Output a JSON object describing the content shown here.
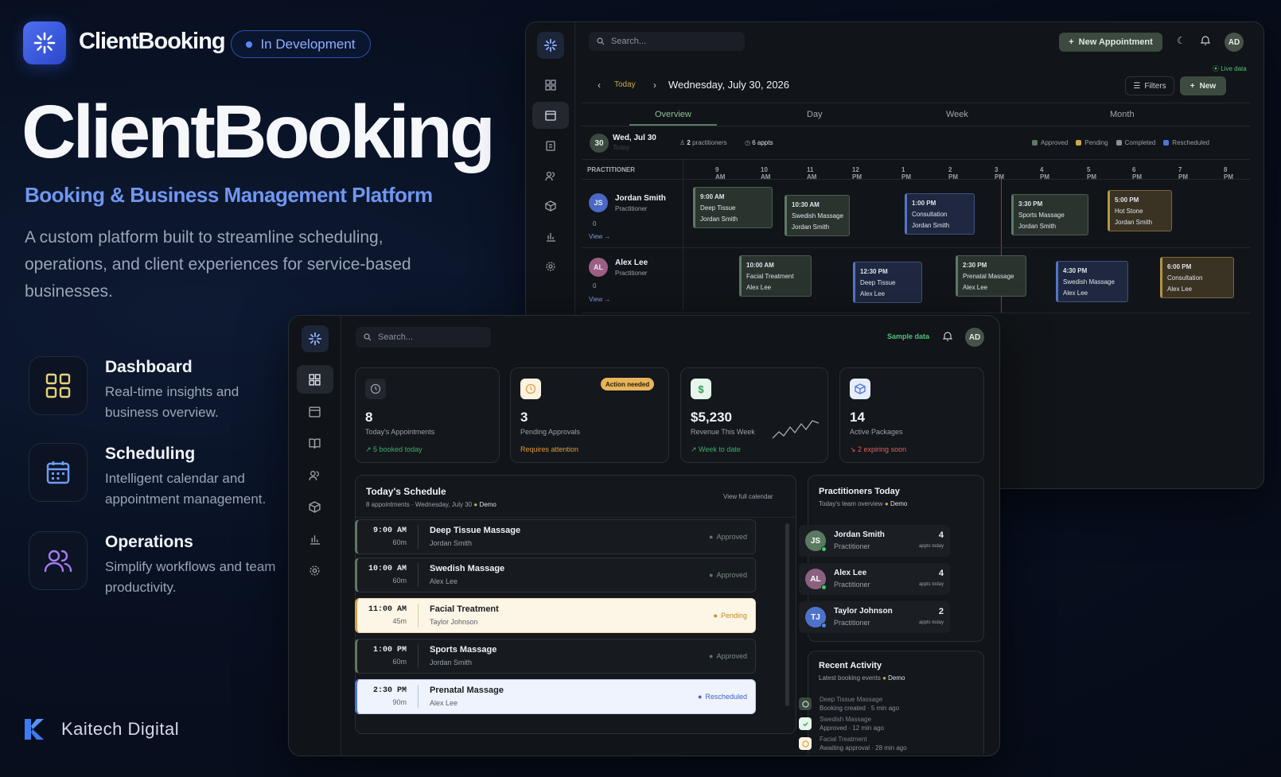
{
  "hero": {
    "brand": "ClientBooking",
    "status_pill": "In Development",
    "title": "ClientBooking",
    "subtitle": "Booking & Business Management Platform",
    "description": "A custom platform built to streamline scheduling, operations, and client experiences for service-based businesses.",
    "features": [
      {
        "title": "Dashboard",
        "desc": "Real-time insights and business overview.",
        "icon": "grid-icon"
      },
      {
        "title": "Scheduling",
        "desc": "Intelligent calendar and appointment management.",
        "icon": "calendar-icon"
      },
      {
        "title": "Operations",
        "desc": "Simplify workflows and team productivity.",
        "icon": "users-icon"
      }
    ],
    "company": "Kaitech Digital"
  },
  "calendar_window": {
    "search_placeholder": "Search...",
    "new_appointment": "New Appointment",
    "avatar": "AD",
    "live_data": "Live data",
    "today": "Today",
    "date": "Wednesday, July 30, 2026",
    "filters": "Filters",
    "new": "New",
    "tabs": [
      "Overview",
      "Day",
      "Week",
      "Month"
    ],
    "day_badge": "30",
    "day_label": "Wed, Jul 30",
    "day_sub": "Today",
    "practitioners_count": "2",
    "practitioners_label": "practitioners",
    "appts": "6 appts",
    "legend": [
      {
        "label": "Approved",
        "color": "#5c7a63"
      },
      {
        "label": "Pending",
        "color": "#c9a94a"
      },
      {
        "label": "Completed",
        "color": "#8a8f96"
      },
      {
        "label": "Rescheduled",
        "color": "#4f74d6"
      }
    ],
    "practitioner_header": "PRACTITIONER",
    "hours": [
      "9 AM",
      "10 AM",
      "11 AM",
      "12 PM",
      "1 PM",
      "2 PM",
      "3 PM",
      "4 PM",
      "5 PM",
      "6 PM",
      "7 PM",
      "8 PM"
    ],
    "rows": [
      {
        "initials": "JS",
        "name": "Jordan Smith",
        "role": "Practitioner",
        "count": "0",
        "view": "View →",
        "appointments": [
          {
            "time": "9:00 AM",
            "service": "Deep Tissue",
            "client": "Jordan Smith",
            "status": "green"
          },
          {
            "time": "10:30 AM",
            "service": "Swedish Massage",
            "client": "Jordan Smith",
            "status": "green"
          },
          {
            "time": "1:00 PM",
            "service": "Consultation",
            "client": "Jordan Smith",
            "status": "blue"
          },
          {
            "time": "3:30 PM",
            "service": "Sports Massage",
            "client": "Jordan Smith",
            "status": "green"
          },
          {
            "time": "5:00 PM",
            "service": "Hot Stone",
            "client": "Jordan Smith",
            "status": "gold"
          }
        ]
      },
      {
        "initials": "AL",
        "name": "Alex Lee",
        "role": "Practitioner",
        "count": "0",
        "view": "View →",
        "appointments": [
          {
            "time": "10:00 AM",
            "service": "Facial Treatment",
            "client": "Alex Lee",
            "status": "green"
          },
          {
            "time": "12:30 PM",
            "service": "Deep Tissue",
            "client": "Alex Lee",
            "status": "blue"
          },
          {
            "time": "2:30 PM",
            "service": "Prenatal Massage",
            "client": "Alex Lee",
            "status": "green"
          },
          {
            "time": "4:30 PM",
            "service": "Swedish Massage",
            "client": "Alex Lee",
            "status": "blue"
          },
          {
            "time": "6:00 PM",
            "service": "Consultation",
            "client": "Alex Lee",
            "status": "gold"
          }
        ]
      }
    ]
  },
  "dashboard_window": {
    "search_placeholder": "Search...",
    "sample_data": "Sample data",
    "avatar": "AD",
    "stats": [
      {
        "value": "8",
        "label": "Today's Appointments",
        "note": "↗ 5 booked today",
        "note_color": "#3fae6a",
        "icon": "clock-icon"
      },
      {
        "value": "3",
        "label": "Pending Approvals",
        "note": "Requires attention",
        "note_color": "#e09a3a",
        "badge": "Action needed",
        "icon": "clock-icon"
      },
      {
        "value": "$5,230",
        "label": "Revenue This Week",
        "note": "↗ Week to date",
        "note_color": "#3fae6a",
        "icon": "dollar-icon"
      },
      {
        "value": "14",
        "label": "Active Packages",
        "note": "↘ 2 expiring soon",
        "note_color": "#e0605a",
        "icon": "package-icon"
      }
    ],
    "schedule": {
      "title": "Today's Schedule",
      "subtitle": "8 appointments · Wednesday, July 30",
      "demo": "Demo",
      "view_full": "View full calendar",
      "items": [
        {
          "time": "9:00 AM",
          "duration": "60m",
          "service": "Deep Tissue Massage",
          "client": "Jordan Smith",
          "status": "Approved"
        },
        {
          "time": "10:00 AM",
          "duration": "60m",
          "service": "Swedish Massage",
          "client": "Alex Lee",
          "status": "Approved"
        },
        {
          "time": "11:00 AM",
          "duration": "45m",
          "service": "Facial Treatment",
          "client": "Taylor Johnson",
          "status": "Pending"
        },
        {
          "time": "1:00 PM",
          "duration": "60m",
          "service": "Sports Massage",
          "client": "Jordan Smith",
          "status": "Approved"
        },
        {
          "time": "2:30 PM",
          "duration": "90m",
          "service": "Prenatal Massage",
          "client": "Alex Lee",
          "status": "Rescheduled"
        }
      ]
    },
    "practitioners": {
      "title": "Practitioners Today",
      "subtitle": "Today's team overview",
      "demo": "Demo",
      "appts_label": "appts today",
      "items": [
        {
          "initials": "JS",
          "name": "Jordan Smith",
          "role": "Practitioner",
          "count": "4",
          "color": "#5a7a62"
        },
        {
          "initials": "AL",
          "name": "Alex Lee",
          "role": "Practitioner",
          "count": "4",
          "color": "#8a6280"
        },
        {
          "initials": "TJ",
          "name": "Taylor Johnson",
          "role": "Practitioner",
          "count": "2",
          "color": "#4f72c9"
        }
      ]
    },
    "activity": {
      "title": "Recent Activity",
      "subtitle": "Latest booking events",
      "demo": "Demo",
      "items": [
        {
          "service": "Deep Tissue Massage",
          "event": "Booking created · 5 min ago"
        },
        {
          "service": "Swedish Massage",
          "event": "Approved · 12 min ago"
        },
        {
          "service": "Facial Treatment",
          "event": "Awaiting approval · 28 min ago"
        }
      ]
    }
  }
}
